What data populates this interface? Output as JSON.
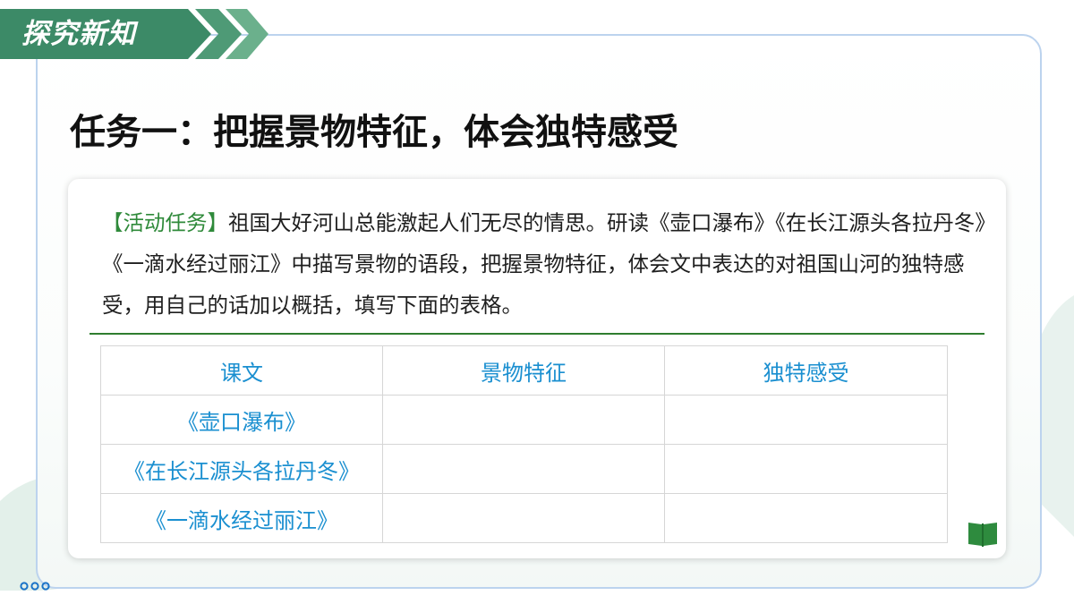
{
  "header": {
    "section_label": "探究新知",
    "banner_color": "#3c8a67"
  },
  "title": "任务一：把握景物特征，体会独特感受",
  "task": {
    "label": "【活动任务】",
    "label_color": "#2f8a3a",
    "text": "祖国大好河山总能激起人们无尽的情思。研读《壶口瀑布》《在长江源头各拉丹冬》《一滴水经过丽江》中描写景物的语段，把握景物特征，体会文中表达的对祖国山河的独特感受，用自己的话加以概括，填写下面的表格。"
  },
  "table": {
    "text_color": "#1a8fd0",
    "headers": [
      "课文",
      "景物特征",
      "独特感受"
    ],
    "rows": [
      [
        "《壶口瀑布》",
        "",
        ""
      ],
      [
        "《在长江源头各拉丹冬》",
        "",
        ""
      ],
      [
        "《一滴水经过丽江》",
        "",
        ""
      ]
    ]
  },
  "icons": {
    "book": "book-icon",
    "dots": "dots-icon"
  }
}
